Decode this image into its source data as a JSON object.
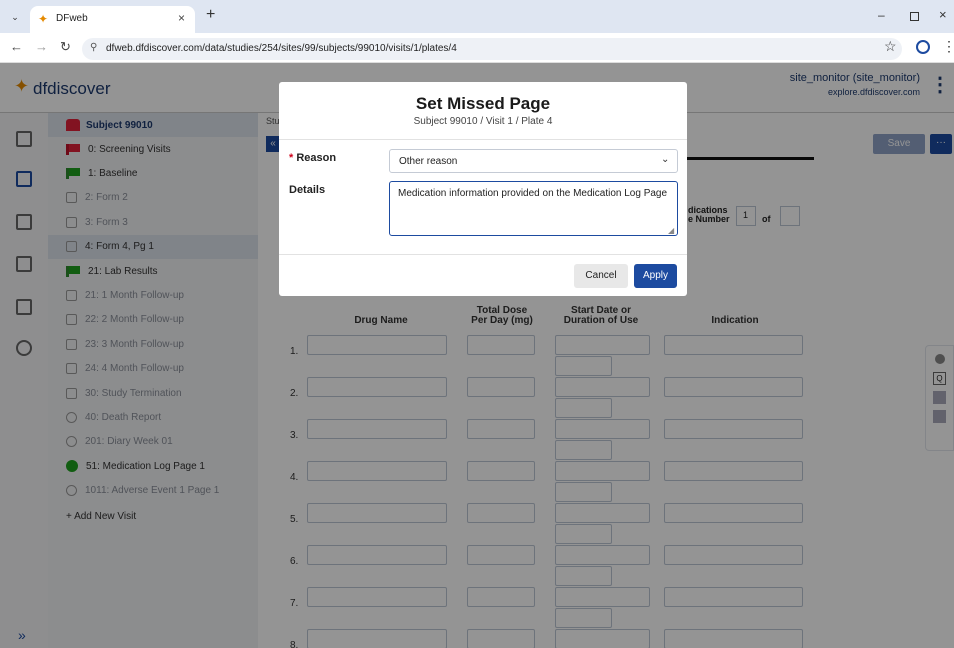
{
  "browser": {
    "tab_title": "DFweb",
    "url": "dfweb.dfdiscover.com/data/studies/254/sites/99/subjects/99010/visits/1/plates/4"
  },
  "app": {
    "logo_text": "dfdiscover",
    "user_name": "site_monitor (site_monitor)",
    "user_host": "explore.dfdiscover.com",
    "save_label": "Save",
    "more_label": "···"
  },
  "sidebar": {
    "subject": "Subject 99010",
    "items": [
      {
        "label": "0: Screening Visits",
        "kind": "rflag",
        "state": "normal"
      },
      {
        "label": "1: Baseline",
        "kind": "gflag",
        "state": "normal"
      },
      {
        "label": "2: Form 2",
        "kind": "square",
        "state": "dim-indent"
      },
      {
        "label": "3: Form 3",
        "kind": "square",
        "state": "dim-indent"
      },
      {
        "label": "4: Form 4, Pg 1",
        "kind": "square",
        "state": "selected-indent"
      },
      {
        "label": "21: Lab Results",
        "kind": "gflag",
        "state": "indent"
      },
      {
        "label": "21: 1 Month Follow-up",
        "kind": "square",
        "state": "dim"
      },
      {
        "label": "22: 2 Month Follow-up",
        "kind": "square",
        "state": "dim"
      },
      {
        "label": "23: 3 Month Follow-up",
        "kind": "square",
        "state": "dim"
      },
      {
        "label": "24: 4 Month Follow-up",
        "kind": "square",
        "state": "dim"
      },
      {
        "label": "30: Study Termination",
        "kind": "square",
        "state": "dim"
      },
      {
        "label": "40: Death Report",
        "kind": "circle",
        "state": "dim"
      },
      {
        "label": "201: Diary Week 01",
        "kind": "circle",
        "state": "dim"
      },
      {
        "label": "51: Medication Log Page 1",
        "kind": "gcircle",
        "state": "normal"
      },
      {
        "label": "1011: Adverse Event 1 Page 1",
        "kind": "circle",
        "state": "dim"
      }
    ],
    "add_visit": "+ Add New Visit",
    "expand": "»"
  },
  "form": {
    "study_label": "Stu",
    "medications_label": "dications",
    "page_number_label": "e Number",
    "page_number_value": "1",
    "of_label": "of",
    "columns": [
      "Drug Name",
      "Total Dose\nPer Day (mg)",
      "Start Date or\nDuration of Use",
      "Indication"
    ],
    "rows": [
      "1.",
      "2.",
      "3.",
      "4.",
      "5.",
      "6.",
      "7.",
      "8."
    ]
  },
  "modal": {
    "title": "Set Missed Page",
    "subtitle": "Subject 99010 / Visit 1 / Plate 4",
    "required_mark": "*",
    "reason_label": "Reason",
    "reason_value": "Other reason",
    "details_label": "Details",
    "details_value": "Medication information provided on the Medication Log Page",
    "cancel_label": "Cancel",
    "apply_label": "Apply"
  },
  "colors": {
    "primary": "#1d4ba0",
    "green": "#1ea01e",
    "red": "#e0213a"
  }
}
